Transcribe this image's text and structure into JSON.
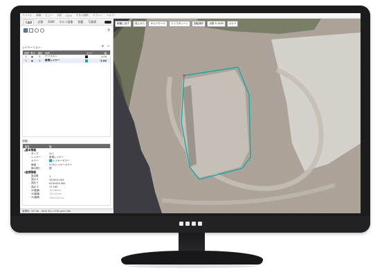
{
  "menubar": [
    "ファイル",
    "編集",
    "ビュー",
    "分析",
    "DSM",
    "そない面積",
    "ラフレン",
    "ヘルプ"
  ],
  "tabs": [
    {
      "label": "CAD",
      "active": true
    },
    {
      "label": "点群",
      "active": false
    },
    {
      "label": "DSM",
      "active": false
    },
    {
      "label": "オルソ画像",
      "active": false
    },
    {
      "label": "測量",
      "active": false
    },
    {
      "label": "写真表",
      "active": false
    }
  ],
  "layers": {
    "title": "レイヤーリスト:",
    "add": "+",
    "remove": "−",
    "columns": [
      "選択",
      "表示",
      "固定",
      "名前",
      "カラー",
      "幅"
    ],
    "rows": [
      {
        "name": "デフォルト",
        "width": "1.00",
        "color": "#1a1a1a",
        "selected": false
      },
      {
        "name": "新規レイヤー",
        "width": "5.00",
        "color": "#18a6a6",
        "selected": true
      }
    ]
  },
  "properties": {
    "title": "詳細:",
    "columns": [
      "属性",
      "値"
    ],
    "groups": [
      {
        "label": "基本情報",
        "rows": [
          {
            "key": "タイプ",
            "value": "線分",
            "muted": true
          },
          {
            "key": "レイヤー",
            "value": "新規レイヤー",
            "muted": false
          },
          {
            "key": "カラー",
            "value": "レイヤーカラー",
            "muted": false,
            "color": "#18a6a6"
          },
          {
            "key": "線幅",
            "value": "5.00 レイヤーカラー",
            "muted": false
          },
          {
            "key": "線の閉じ",
            "value": "閉",
            "muted": false
          }
        ]
      },
      {
        "label": "座標情報",
        "rows": [
          {
            "key": "頂点数",
            "value": "1",
            "muted": false
          },
          {
            "key": "頂点 X",
            "value": "307624.009",
            "muted": false
          },
          {
            "key": "頂点 Y",
            "value": "6240426.062",
            "muted": false
          },
          {
            "key": "頂点 Z",
            "value": "17.169",
            "muted": false
          },
          {
            "key": "2D距離",
            "value": "155.894m",
            "muted": true
          },
          {
            "key": "3D距離",
            "value": "155.022m",
            "muted": true
          },
          {
            "key": "2D面積",
            "value": "1993.523 m²",
            "muted": true
          }
        ]
      }
    ]
  },
  "status": "座標系: 32756 – WGS 84 / UTM zone 56S",
  "toolbar": [
    "俯瞰に戻す",
    "真上から",
    "オルソモード",
    "ミリマガシーン",
    "回転操作",
    "点群 & DSM",
    "カメラ"
  ],
  "colors": {
    "accent": "#18a6a6",
    "selection": "#5d7fa8",
    "header": "#6a6a6a"
  }
}
